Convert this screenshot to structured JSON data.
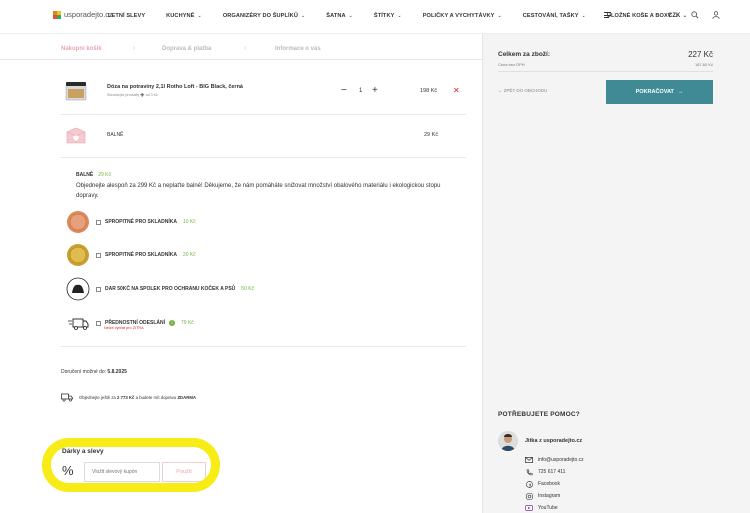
{
  "header": {
    "logo_text": "usporadejto.cz",
    "nav": [
      {
        "label": "LETNÍ SLEVY",
        "dropdown": false
      },
      {
        "label": "KUCHYNĚ",
        "dropdown": true
      },
      {
        "label": "ORGANIZÉRY DO ŠUPLÍKŮ",
        "dropdown": true
      },
      {
        "label": "ŠATNA",
        "dropdown": true
      },
      {
        "label": "ŠTÍTKY",
        "dropdown": true
      },
      {
        "label": "POLIČKY A VYCHYTÁVKY",
        "dropdown": true
      },
      {
        "label": "CESTOVÁNÍ, TAŠKY",
        "dropdown": true
      },
      {
        "label": "ÚLOŽNÉ KOŠE A BOXY",
        "dropdown": true
      }
    ],
    "currency": "CZK",
    "icons": [
      "menu-icon",
      "search-icon",
      "user-icon"
    ]
  },
  "steps": [
    "Nákupní košík",
    "Doprava & platba",
    "Informace o vás"
  ],
  "cart": {
    "product": {
      "name": "Dóza na potraviny 2,1l Rotho Loft - BIG Black, černá",
      "sub": "Související produkty ➕ od 3 Kč",
      "qty": "1",
      "price": "198 Kč"
    },
    "packaging": {
      "name": "BALNĚ",
      "price": "29 Kč"
    },
    "pack_info": {
      "title": "BALNĚ",
      "price": "29 Kč",
      "desc": "Objednejte alespoň za 299 Kč a neplaťte balné! Děkujeme, že nám pomáháte snižovat množství obalového materiálu i ekologickou stopu dopravy."
    },
    "options": [
      {
        "label": "SPROPITNÉ PRO SKLADNÍKA",
        "price": "10 Kč"
      },
      {
        "label": "SPROPITNÉ PRO SKLADNÍKA",
        "price": "20 Kč"
      },
      {
        "label": "DAR 50KČ NA SPOLEK PRO OCHRANU KOČEK A PSŮ",
        "price": "50 Kč"
      },
      {
        "label": "PŘEDNOSTNÍ ODESLÁNÍ",
        "price": "79 Kč"
      }
    ],
    "priority_note": "Nelze vybrat pro ZITRA",
    "delivery": {
      "label": "Doručení možné do:",
      "date": "5.8.2025"
    },
    "free_shipping": {
      "text_before": "Objednejte ještě za ",
      "amount": "2 773 Kč",
      "text_mid": " a budete mít dopravu ",
      "free": "ZDARMA"
    },
    "gifts_title": "Dárky a slevy",
    "coupon_placeholder": "Vložit slevový kupón",
    "coupon_button": "Použít"
  },
  "summary": {
    "total_label": "Celkem za zboží:",
    "total": "227 Kč",
    "vat_label": "Cena bez DPH",
    "vat_value": "187,60 Kč",
    "back_label": "ZPĚT DO OBCHODU",
    "continue_label": "POKRAČOVAT"
  },
  "help": {
    "title": "POTŘEBUJETE POMOC?",
    "agent": "Jitka z usporadejto.cz",
    "contacts": [
      {
        "icon": "mail-icon",
        "text": "info@usporadejto.cz"
      },
      {
        "icon": "phone-icon",
        "text": "725 617 411"
      },
      {
        "icon": "facebook-icon",
        "text": "Facebook"
      },
      {
        "icon": "instagram-icon",
        "text": "Instagram"
      },
      {
        "icon": "youtube-icon",
        "text": "YouTube"
      }
    ]
  },
  "colors": {
    "accent": "#3f8a95",
    "pink": "#e8a7b0",
    "green": "#76b043",
    "red": "#d9262c",
    "highlight": "#f7ec16"
  }
}
